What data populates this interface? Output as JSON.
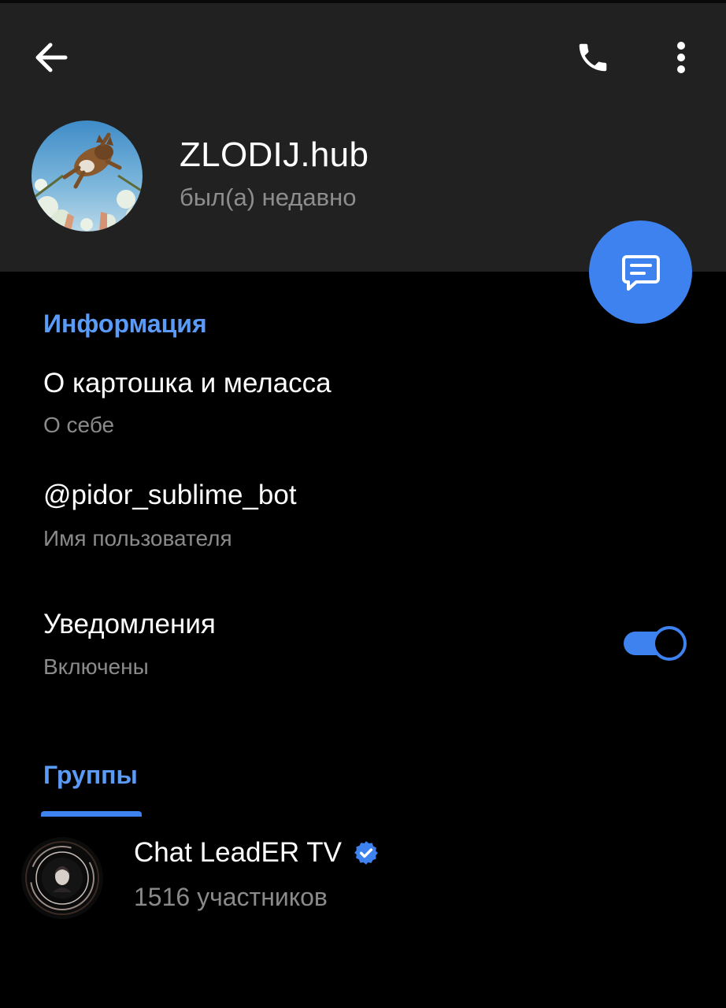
{
  "header": {
    "name": "ZLODIJ.hub",
    "status": "был(а) недавно",
    "back_icon": "arrow-left-icon",
    "call_icon": "phone-icon",
    "more_icon": "more-vertical-icon",
    "fab_icon": "message-icon"
  },
  "info": {
    "section_title": "Информация",
    "bio": {
      "value": "О картошка и меласса",
      "label": "О себе"
    },
    "username": {
      "value": "@pidor_sublime_bot",
      "label": "Имя пользователя"
    },
    "notifications": {
      "title": "Уведомления",
      "state": "Включены",
      "enabled": true
    }
  },
  "groups": {
    "tab_label": "Группы",
    "items": [
      {
        "name": "Chat LeadER TV",
        "verified": true,
        "members": "1516 участников"
      }
    ]
  },
  "colors": {
    "accent": "#3e82f0",
    "section_title": "#5a9bf7",
    "header_bg": "#212121",
    "body_bg": "#000000",
    "secondary_text": "#8a8a8a"
  }
}
